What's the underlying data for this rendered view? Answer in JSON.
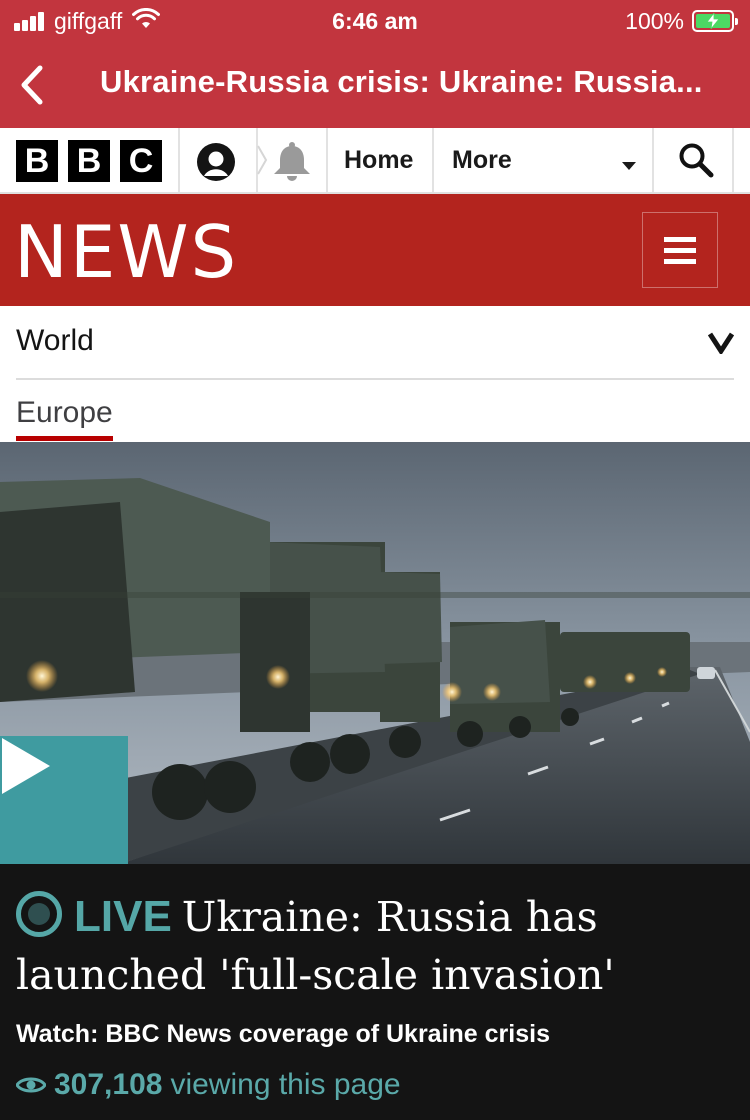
{
  "status_bar": {
    "carrier": "giffgaff",
    "time": "6:46 am",
    "battery": "100%",
    "signal_bars": 4,
    "battery_charging": true
  },
  "nav_bar": {
    "title": "Ukraine-Russia crisis: Ukraine: Russia...",
    "back_icon": "chevron-left-icon"
  },
  "masthead": {
    "logo_letters": [
      "B",
      "B",
      "C"
    ],
    "account_icon": "account-icon",
    "notification_icon": "bell-icon",
    "home_label": "Home",
    "more_label": "More",
    "search_icon": "search-icon"
  },
  "news_banner": {
    "title": "NEWS",
    "menu_icon": "hamburger-menu-icon"
  },
  "section_nav": {
    "current": "World",
    "subsection": "Europe"
  },
  "hero": {
    "play_icon": "play-icon"
  },
  "live_story": {
    "live_label": "LIVE",
    "headline": "Ukraine: Russia has launched 'full-scale invasion'",
    "subheading": "Watch: BBC News coverage of Ukraine crisis",
    "viewer_count": "307,108",
    "viewer_suffix": "viewing this page"
  },
  "colors": {
    "app_bar": "#c2353e",
    "news_banner": "#b3241e",
    "live_teal": "#55a7a7",
    "panel_bg": "#141414",
    "europe_underline": "#b80000"
  }
}
